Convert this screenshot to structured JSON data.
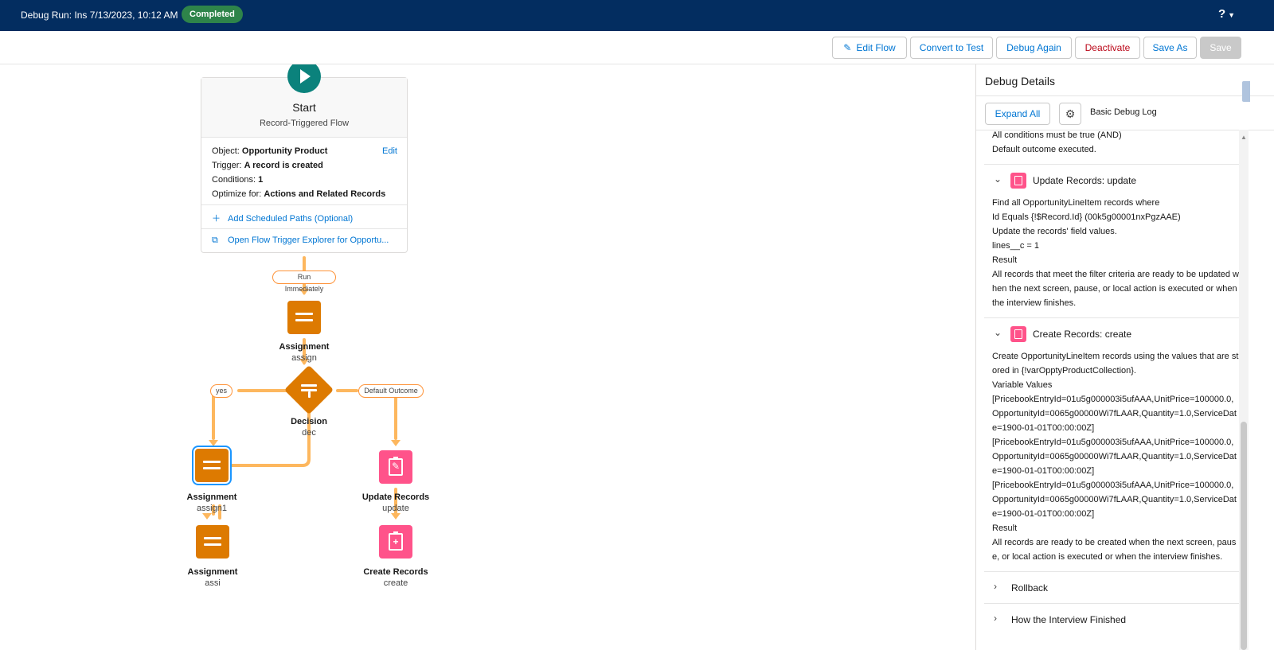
{
  "topbar": {
    "title": "Debug Run: Ins 7/13/2023, 10:12 AM",
    "status": "Completed",
    "help": "?"
  },
  "toolbar": {
    "edit_flow": "Edit Flow",
    "convert_to_test": "Convert to Test",
    "debug_again": "Debug Again",
    "deactivate": "Deactivate",
    "save_as": "Save As",
    "save": "Save"
  },
  "canvas": {
    "start": {
      "title": "Start",
      "subtitle": "Record-Triggered Flow",
      "object_label": "Object:",
      "object_value": "Opportunity Product",
      "trigger_label": "Trigger:",
      "trigger_value": "A record is created",
      "conditions_label": "Conditions:",
      "conditions_value": "1",
      "optimize_label": "Optimize for:",
      "optimize_value": "Actions and Related Records",
      "edit": "Edit",
      "add_scheduled": "Add Scheduled Paths (Optional)",
      "open_explorer": "Open Flow Trigger Explorer for Opportu..."
    },
    "pills": {
      "run_immediately": "Run Immediately",
      "yes": "yes",
      "default_outcome": "Default Outcome"
    },
    "nodes": {
      "assign_top": {
        "type": "Assignment",
        "api": "assign"
      },
      "decision": {
        "type": "Decision",
        "api": "dec"
      },
      "assign1": {
        "type": "Assignment",
        "api": "assign1"
      },
      "update": {
        "type": "Update Records",
        "api": "update"
      },
      "assi": {
        "type": "Assignment",
        "api": "assi"
      },
      "create": {
        "type": "Create Records",
        "api": "create"
      }
    }
  },
  "panel": {
    "title": "Debug Details",
    "expand_all": "Expand All",
    "basic_debug_log": "Basic Debug Log",
    "intro_lines": [
      "All conditions must be true (AND)",
      "Default outcome executed."
    ],
    "update_section": {
      "title": "Update Records: update",
      "lines": [
        "Find all OpportunityLineItem records where",
        "Id Equals {!$Record.Id} (00k5g00001nxPgzAAE)",
        "Update the records' field values.",
        "lines__c = 1",
        "Result",
        "All records that meet the filter criteria are ready to be updated when the next screen, pause, or local action is executed or when the interview finishes."
      ]
    },
    "create_section": {
      "title": "Create Records: create",
      "lines": [
        "Create OpportunityLineItem records using the values that are stored in {!varOpptyProductCollection}.",
        "Variable Values",
        "[PricebookEntryId=01u5g000003i5ufAAA,UnitPrice=100000.0,OpportunityId=0065g00000Wi7fLAAR,Quantity=1.0,ServiceDate=1900-01-01T00:00:00Z]",
        "[PricebookEntryId=01u5g000003i5ufAAA,UnitPrice=100000.0,OpportunityId=0065g00000Wi7fLAAR,Quantity=1.0,ServiceDate=1900-01-01T00:00:00Z]",
        "[PricebookEntryId=01u5g000003i5ufAAA,UnitPrice=100000.0,OpportunityId=0065g00000Wi7fLAAR,Quantity=1.0,ServiceDate=1900-01-01T00:00:00Z]",
        "Result",
        "All records are ready to be created when the next screen, pause, or local action is executed or when the interview finishes."
      ]
    },
    "rollback": "Rollback",
    "how_finished": "How the Interview Finished"
  },
  "colors": {
    "header_bg": "#032d60",
    "status_green": "#2e844a",
    "assignment_orange": "#dd7a01",
    "records_pink": "#ff538a",
    "start_teal": "#0b827c",
    "connector": "#fdb75e",
    "link_blue": "#0176d3",
    "danger_red": "#ba0517"
  },
  "icons": {
    "edit_flow": "pencil-icon",
    "help": "question-icon",
    "play": "play-icon",
    "add": "plus-icon",
    "external": "external-link-icon",
    "gear": "gear-icon",
    "chevron": "chevron-icon"
  }
}
